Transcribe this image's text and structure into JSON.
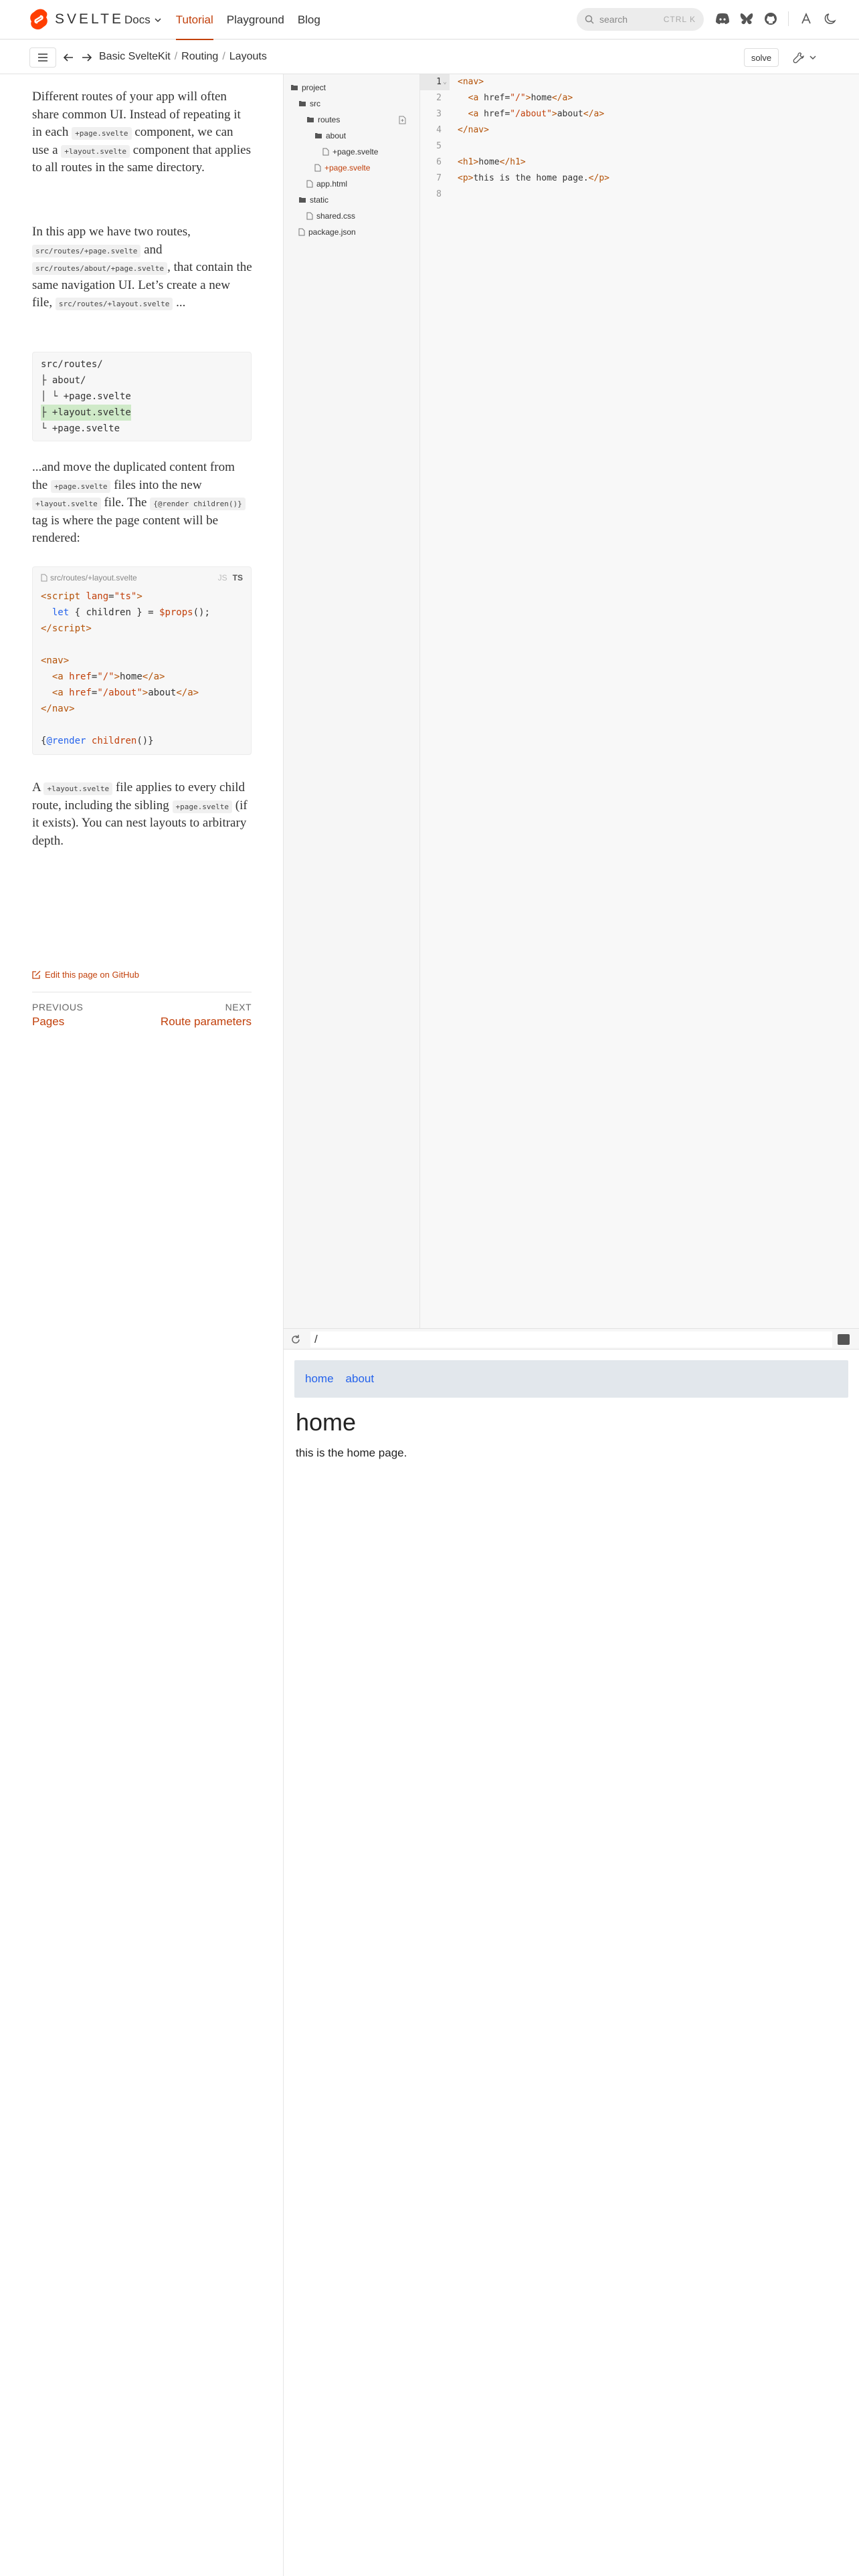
{
  "brand": {
    "name": "SVELTE",
    "accent": "#c2410c"
  },
  "nav": {
    "links": [
      {
        "label": "Docs"
      },
      {
        "label": "Tutorial"
      },
      {
        "label": "Playground"
      },
      {
        "label": "Blog"
      }
    ]
  },
  "search": {
    "placeholder": "search",
    "shortcut": "CTRL K"
  },
  "breadcrumb": {
    "part1": "Basic SvelteKit",
    "part2": "Routing",
    "part3": "Layouts"
  },
  "toolbar": {
    "solve_label": "solve"
  },
  "content": {
    "p1_a": "Different routes of your app will often share common UI. Instead of repeating it in each",
    "p1_code1": "+page.svelte",
    "p1_b": "component, we can use a",
    "p1_code2": "+layout.svelte",
    "p1_c": "component that applies to all routes in the same directory.",
    "p2_a": "In this app we have two routes,",
    "p2_code1": "src/routes/+page.svelte",
    "p2_b": "and",
    "p2_code2": "src/routes/about/+page.svelte",
    "p2_c": ", that contain the same navigation UI. Let’s create a new file,",
    "p2_code3": "src/routes/+layout.svelte",
    "p2_d": "...",
    "tree_block": [
      "src/routes/",
      "├ about/",
      "│ └ +page.svelte",
      "├ +layout.svelte",
      "└ +page.svelte"
    ],
    "p3_a": "...and move the duplicated content from the",
    "p3_code1": "+page.svelte",
    "p3_b": "files into the new",
    "p3_code2": "+layout.svelte",
    "p3_c": "file. The",
    "p3_code3": "{@render children()}",
    "p3_d": "tag is where the page content will be rendered:",
    "code_file": "src/routes/+layout.svelte",
    "code_lang": "TS",
    "p4_a": "A",
    "p4_code1": "+layout.svelte",
    "p4_b": "file applies to every child route, including the sibling",
    "p4_code2": "+page.svelte",
    "p4_c": "(if it exists). You can nest layouts to arbitrary depth.",
    "edit_label": "Edit this page on GitHub",
    "prev_label": "PREVIOUS",
    "prev_link": "Pages",
    "next_label": "NEXT",
    "next_link": "Route parameters"
  },
  "files": {
    "project": "project",
    "src": "src",
    "routes": "routes",
    "about": "about",
    "about_page": "+page.svelte",
    "root_page": "+page.svelte",
    "app_html": "app.html",
    "static": "static",
    "shared_css": "shared.css",
    "package_json": "package.json"
  },
  "editor": {
    "line_numbers": [
      "1",
      "2",
      "3",
      "4",
      "5",
      "6",
      "7",
      "8"
    ]
  },
  "preview": {
    "url": "/",
    "nav_home": "home",
    "nav_about": "about",
    "heading": "home",
    "text": "this is the home page."
  }
}
